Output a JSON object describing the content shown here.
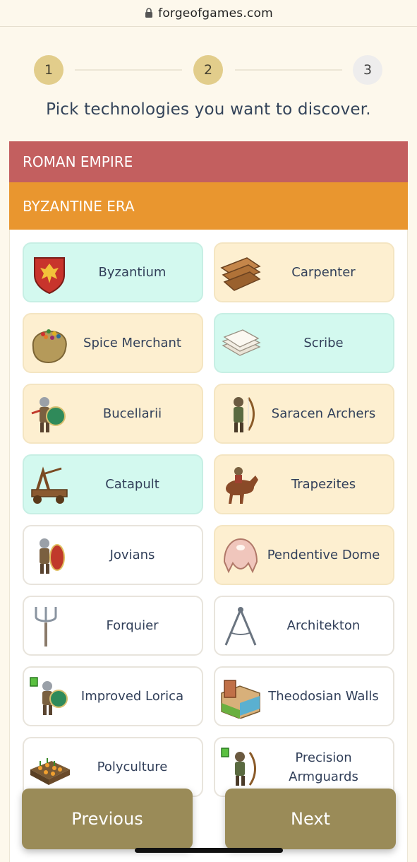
{
  "browser": {
    "url": "forgeofgames.com"
  },
  "stepper": {
    "steps": [
      "1",
      "2",
      "3"
    ],
    "current": 2
  },
  "instruction": "Pick technologies you want to discover.",
  "age": "ROMAN EMPIRE",
  "era": "BYZANTINE ERA",
  "colors": {
    "discovered": "#d3f9ef",
    "available": "#fdefd0",
    "locked": "#ffffff",
    "age_bar": "#c35f5f",
    "era_bar": "#e9962f",
    "buttons": "#9a8b58"
  },
  "technologies": [
    {
      "name": "Byzantium",
      "state": "discovered",
      "icon": "eagle-shield-icon"
    },
    {
      "name": "Carpenter",
      "state": "available",
      "icon": "wooden-planks-icon"
    },
    {
      "name": "Spice Merchant",
      "state": "available",
      "icon": "spice-sack-icon"
    },
    {
      "name": "Scribe",
      "state": "discovered",
      "icon": "paper-stack-icon"
    },
    {
      "name": "Bucellarii",
      "state": "available",
      "icon": "shield-soldier-icon"
    },
    {
      "name": "Saracen Archers",
      "state": "available",
      "icon": "archer-icon"
    },
    {
      "name": "Catapult",
      "state": "discovered",
      "icon": "catapult-icon"
    },
    {
      "name": "Trapezites",
      "state": "available",
      "icon": "horse-rider-icon"
    },
    {
      "name": "Jovians",
      "state": "locked",
      "icon": "red-shield-soldier-icon"
    },
    {
      "name": "Pendentive Dome",
      "state": "available",
      "icon": "dome-icon"
    },
    {
      "name": "Forquier",
      "state": "locked",
      "icon": "pitchfork-icon"
    },
    {
      "name": "Architekton",
      "state": "locked",
      "icon": "compass-icon"
    },
    {
      "name": "Improved Lorica",
      "state": "locked",
      "icon": "upgraded-soldier-icon"
    },
    {
      "name": "Theodosian Walls",
      "state": "locked",
      "icon": "city-walls-icon"
    },
    {
      "name": "Polyculture",
      "state": "locked",
      "icon": "crop-field-icon"
    },
    {
      "name": "Precision Armguards",
      "state": "locked",
      "icon": "upgraded-archer-icon"
    }
  ],
  "buttons": {
    "previous": "Previous",
    "next": "Next"
  }
}
